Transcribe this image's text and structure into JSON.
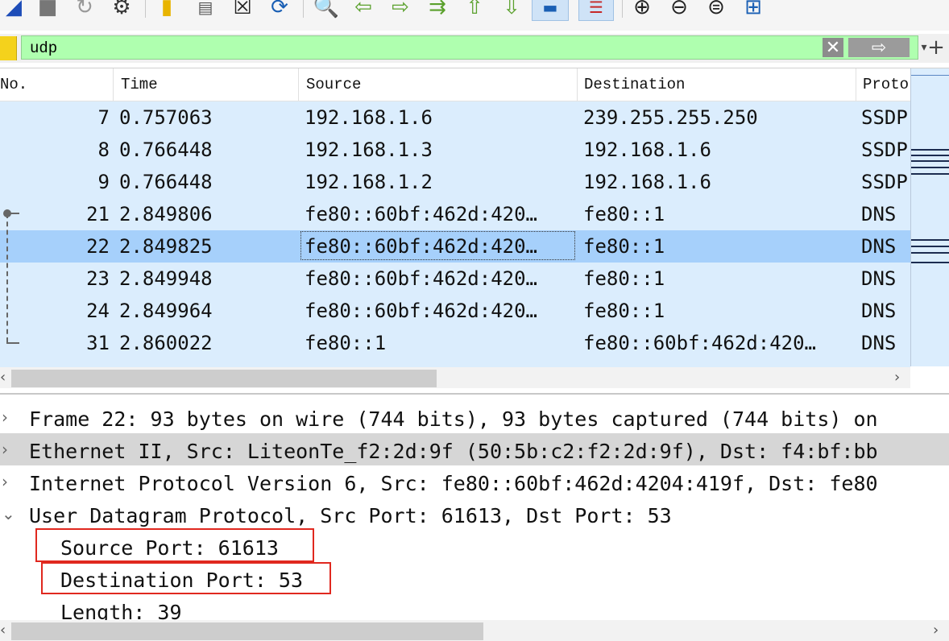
{
  "toolbar": {
    "icons": [
      "shark-fin-icon",
      "stop-icon",
      "reload-icon",
      "options-icon",
      "open-folder-icon",
      "save-file-icon",
      "close-file-icon",
      "reload-file-icon",
      "find-icon",
      "go-back-icon",
      "go-forward-icon",
      "go-to-packet-icon",
      "first-packet-icon",
      "last-packet-icon",
      "autoscroll-icon",
      "colorize-icon",
      "zoom-in-icon",
      "zoom-out-icon",
      "zoom-normal-icon",
      "resize-columns-icon"
    ]
  },
  "filter": {
    "value": "udp",
    "clear_symbol": "✕",
    "apply_symbol": "⇨",
    "dropdown_symbol": "▾",
    "add_symbol": "+"
  },
  "packet_list": {
    "columns": [
      "No.",
      "Time",
      "Source",
      "Destination",
      "Proto"
    ],
    "rows": [
      {
        "no": "7",
        "time": "0.757063",
        "source": "192.168.1.6",
        "destination": "239.255.255.250",
        "protocol": "SSDP"
      },
      {
        "no": "8",
        "time": "0.766448",
        "source": "192.168.1.3",
        "destination": "192.168.1.6",
        "protocol": "SSDP"
      },
      {
        "no": "9",
        "time": "0.766448",
        "source": "192.168.1.2",
        "destination": "192.168.1.6",
        "protocol": "SSDP"
      },
      {
        "no": "21",
        "time": "2.849806",
        "source": "fe80::60bf:462d:420…",
        "destination": "fe80::1",
        "protocol": "DNS"
      },
      {
        "no": "22",
        "time": "2.849825",
        "source": "fe80::60bf:462d:420…",
        "destination": "fe80::1",
        "protocol": "DNS"
      },
      {
        "no": "23",
        "time": "2.849948",
        "source": "fe80::60bf:462d:420…",
        "destination": "fe80::1",
        "protocol": "DNS"
      },
      {
        "no": "24",
        "time": "2.849964",
        "source": "fe80::60bf:462d:420…",
        "destination": "fe80::1",
        "protocol": "DNS"
      },
      {
        "no": "31",
        "time": "2.860022",
        "source": "fe80::1",
        "destination": "fe80::60bf:462d:420…",
        "protocol": "DNS"
      }
    ],
    "selected_row": "22",
    "scroll_left": "‹",
    "scroll_right": "›",
    "row_colors": {
      "normal": "#dbedfd",
      "selected": "#a6d0fb"
    }
  },
  "details": {
    "rows": [
      {
        "expander": "›",
        "text": "Frame 22: 93 bytes on wire (744 bits), 93 bytes captured (744 bits) on"
      },
      {
        "expander": "›",
        "text": "Ethernet II, Src: LiteonTe_f2:2d:9f (50:5b:c2:f2:2d:9f), Dst: f4:bf:bb"
      },
      {
        "expander": "›",
        "text": "Internet Protocol Version 6, Src: fe80::60bf:462d:4204:419f, Dst: fe80"
      },
      {
        "expander": "⌄",
        "text": "User Datagram Protocol, Src Port: 61613, Dst Port: 53"
      }
    ],
    "udp_fields": [
      {
        "text": "Source Port: 61613"
      },
      {
        "text": "Destination Port: 53"
      },
      {
        "text": "Length: 39"
      }
    ],
    "scroll_left": "‹",
    "scroll_right": "›",
    "highlight_color": "#e0281f"
  }
}
